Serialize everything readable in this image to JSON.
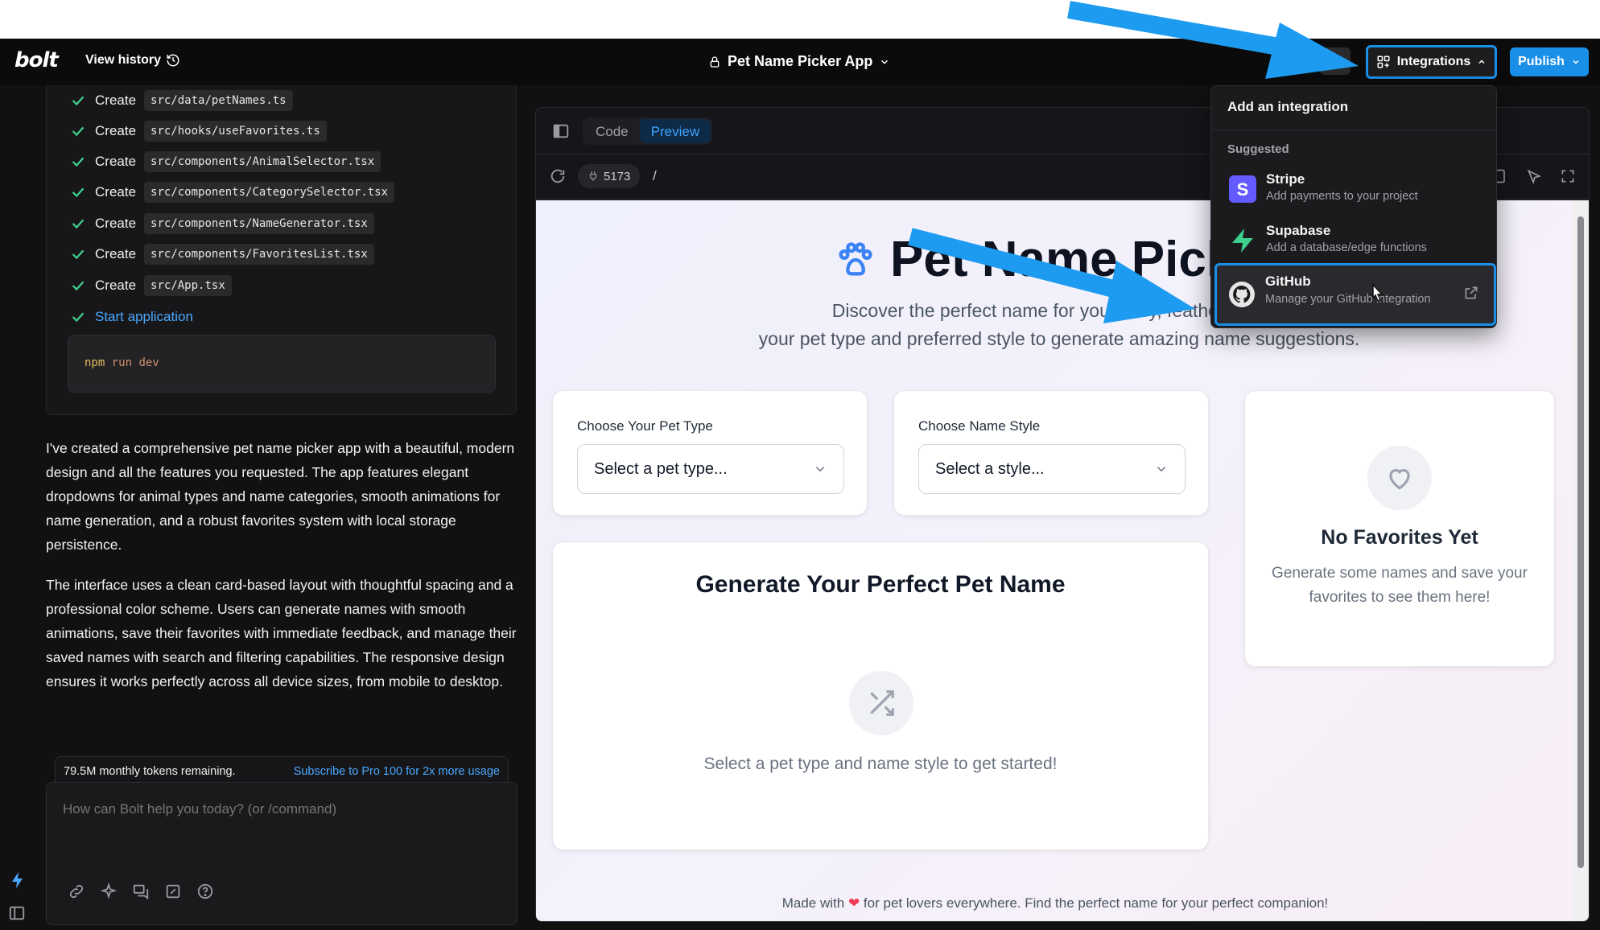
{
  "header": {
    "logo": "bolt",
    "view_history": "View history",
    "project_title": "Pet Name Picker App",
    "integrations_label": "Integrations",
    "publish_label": "Publish"
  },
  "chat": {
    "steps": [
      {
        "action": "Create",
        "file": "src/data/petNames.ts"
      },
      {
        "action": "Create",
        "file": "src/hooks/useFavorites.ts"
      },
      {
        "action": "Create",
        "file": "src/components/AnimalSelector.tsx"
      },
      {
        "action": "Create",
        "file": "src/components/CategorySelector.tsx"
      },
      {
        "action": "Create",
        "file": "src/components/NameGenerator.tsx"
      },
      {
        "action": "Create",
        "file": "src/components/FavoritesList.tsx"
      },
      {
        "action": "Create",
        "file": "src/App.tsx"
      }
    ],
    "start_label": "Start application",
    "command_npm": "npm",
    "command_rest": "run dev",
    "paragraph_1": "I've created a comprehensive pet name picker app with a beautiful, modern design and all the features you requested. The app features elegant dropdowns for animal types and name categories, smooth animations for name generation, and a robust favorites system with local storage persistence.",
    "paragraph_2": "The interface uses a clean card-based layout with thoughtful spacing and a professional color scheme. Users can generate names with smooth animations, save their favorites with immediate feedback, and manage their saved names with search and filtering capabilities. The responsive design ensures it works perfectly across all device sizes, from mobile to desktop.",
    "tokens_remaining": "79.5M monthly tokens remaining.",
    "subscribe_link": "Subscribe to Pro 100 for 2x more usage",
    "prompt_placeholder": "How can Bolt help you today? (or /command)"
  },
  "preview": {
    "tab_code": "Code",
    "tab_preview": "Preview",
    "port": "5173",
    "path": "/"
  },
  "app": {
    "title": "Pet Name Picker",
    "subtitle_line1": "Discover the perfect name for your furry, feathered, or s",
    "subtitle_line2": "your pet type and preferred style to generate amazing name suggestions.",
    "pet_type_label": "Choose Your Pet Type",
    "pet_type_placeholder": "Select a pet type...",
    "style_label": "Choose Name Style",
    "style_placeholder": "Select a style...",
    "generate_title": "Generate Your Perfect Pet Name",
    "generate_hint": "Select a pet type and name style to get started!",
    "favorites_title": "No Favorites Yet",
    "favorites_text": "Generate some names and save your favorites to see them here!",
    "footer_pre": "Made with",
    "footer_post": "for pet lovers everywhere. Find the perfect name for your perfect companion!"
  },
  "integrations_menu": {
    "title": "Add an integration",
    "section": "Suggested",
    "items": [
      {
        "name": "Stripe",
        "desc": "Add payments to your project"
      },
      {
        "name": "Supabase",
        "desc": "Add a database/edge functions"
      },
      {
        "name": "GitHub",
        "desc": "Manage your GitHub integration"
      }
    ]
  },
  "colors": {
    "accent": "#1a8fe8",
    "arrow": "#1d9bf0",
    "check": "#3ecf8e",
    "stripe": "#635bff",
    "supabase": "#3ecf8e"
  }
}
